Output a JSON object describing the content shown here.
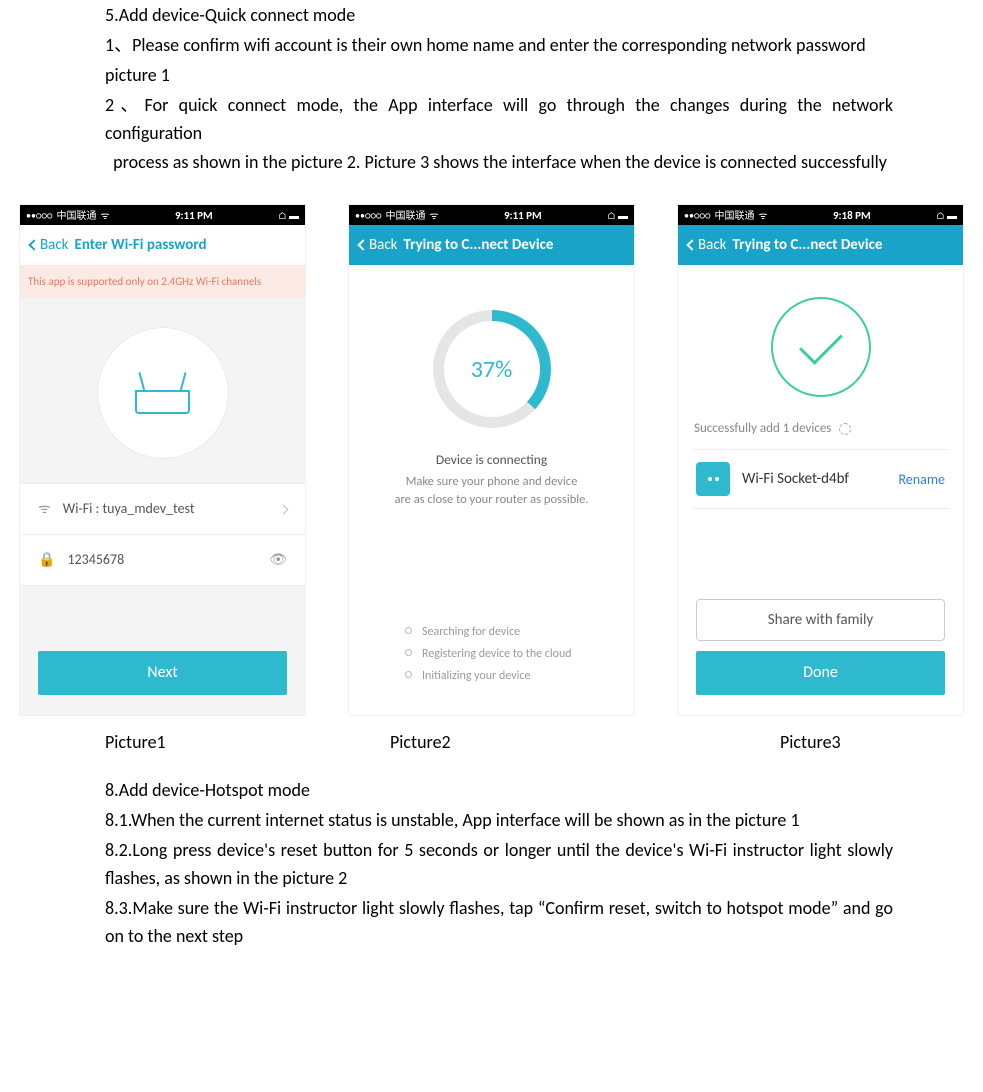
{
  "doc": {
    "section5_title": "5.Add device-Quick connect mode",
    "p1": "1、Please confirm wifi account is their own home name and enter the corresponding network password",
    "pic1": "picture 1",
    "p2": "2、For quick connect mode, the App interface will go through the changes during the network configuration",
    "p2b": "  process as shown in the picture 2. Picture 3 shows the interface when the device is connected successfully",
    "caption1": "Picture1",
    "caption2": "Picture2",
    "caption3": "Picture3",
    "section8_title": "8.Add device-Hotspot mode",
    "p81": "8.1.When the current internet status is unstable, App interface will be shown as in the picture 1",
    "p82": "8.2.Long press device's reset button for 5 seconds or longer until the device's Wi-Fi instructor light slowly flashes, as shown in the picture 2",
    "p83": "8.3.Make sure the Wi-Fi instructor light slowly flashes, tap “Confirm reset, switch to hotspot mode”  and go on to the next step"
  },
  "status": {
    "carrier": "中国联通",
    "time1": "9:11 PM",
    "time2": "9:11 PM",
    "time3": "9:18 PM",
    "dots": "••○○○",
    "wifi": "ᯤ",
    "right": "⌂ ▬"
  },
  "screen1": {
    "back": "Back",
    "title": "Enter Wi-Fi password",
    "notice": "This app is supported only on 2.4GHz Wi-Fi channels",
    "wifi_label": "Wi-Fi : tuya_mdev_test",
    "password": "12345678",
    "next": "Next"
  },
  "screen2": {
    "back": "Back",
    "title": "Trying to C...nect Device",
    "progress": "37%",
    "connecting": "Device is connecting",
    "hint1": "Make sure your phone and device",
    "hint2": "are as close to your router as possible.",
    "steps": [
      "Searching for device",
      "Registering device to the cloud",
      "Initializing your device"
    ]
  },
  "screen3": {
    "back": "Back",
    "title": "Trying to C...nect Device",
    "success": "Successfully add 1 devices",
    "device": "Wi-Fi Socket-d4bf",
    "rename": "Rename",
    "share": "Share with family",
    "done": "Done",
    "socket_glyph": "⏻"
  }
}
